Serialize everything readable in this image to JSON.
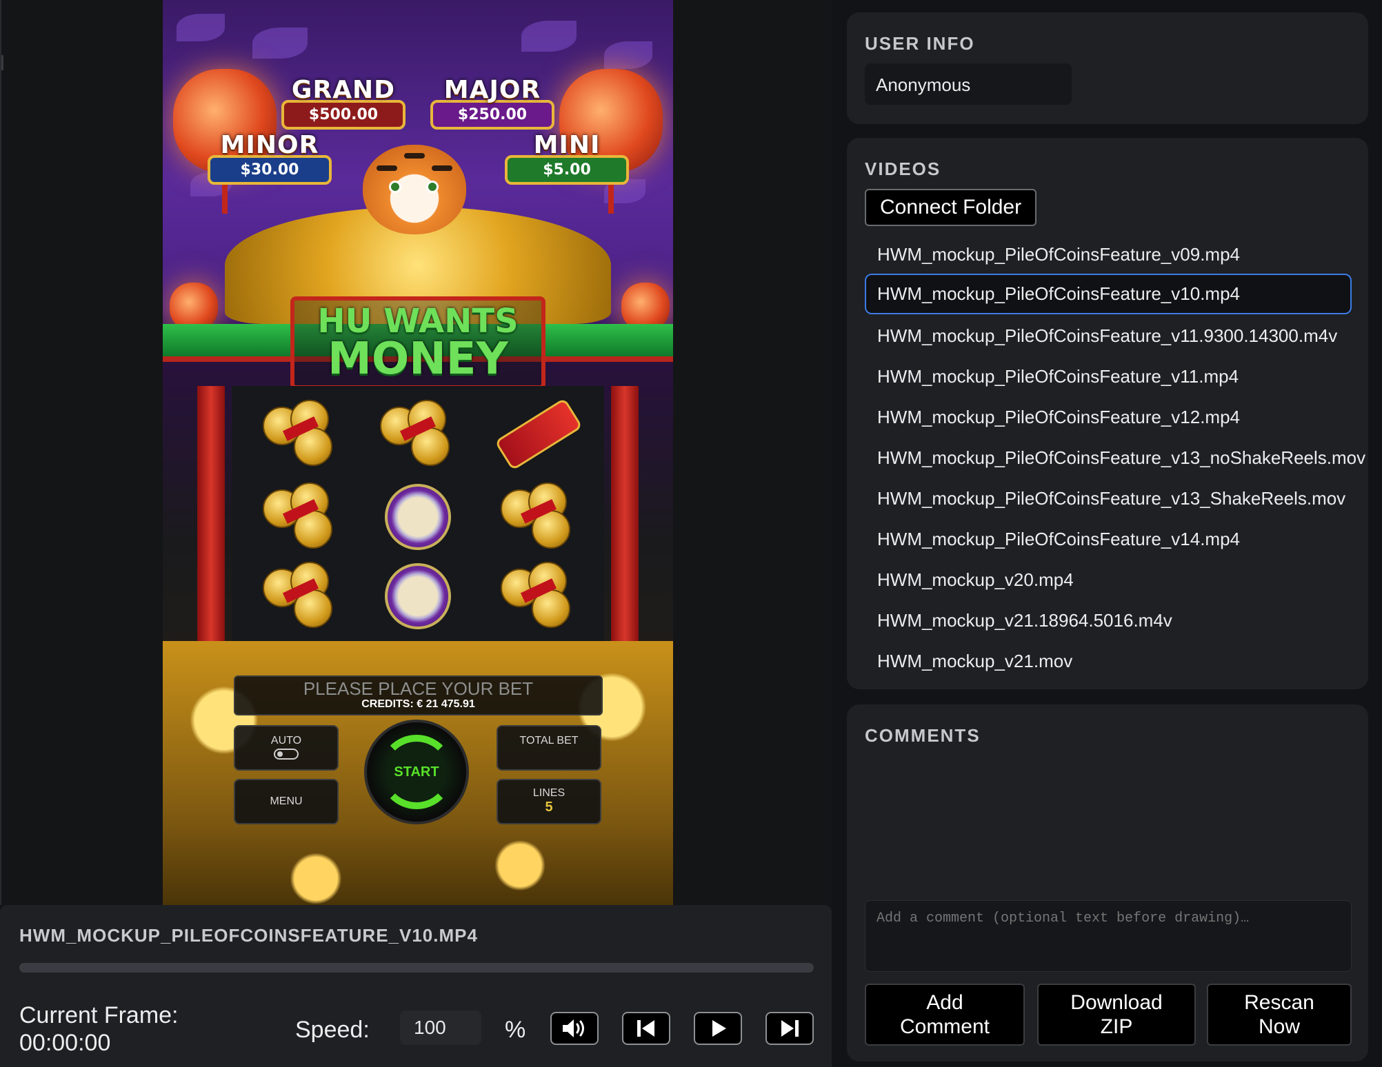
{
  "game": {
    "jackpots": [
      {
        "name": "GRAND",
        "value": "$500.00",
        "color": "#8e1b1b"
      },
      {
        "name": "MAJOR",
        "value": "$250.00",
        "color": "#6a1a8a"
      },
      {
        "name": "MINOR",
        "value": "$30.00",
        "color": "#1a3e8a"
      },
      {
        "name": "MINI",
        "value": "$5.00",
        "color": "#1f7a2a"
      }
    ],
    "title_line1": "HU WANTS",
    "title_line2": "MONEY",
    "bet_message": "PLEASE PLACE YOUR BET",
    "credits": "CREDITS: € 21 475.91",
    "buttons": {
      "auto": "AUTO",
      "menu": "MENU",
      "total_bet": "TOTAL BET",
      "lines": "LINES",
      "lines_value": "5",
      "start": "START"
    },
    "reel_symbols": [
      [
        "coins",
        "coins",
        "firecracker"
      ],
      [
        "coins",
        "drum",
        "coins"
      ],
      [
        "coins",
        "drum",
        "coins"
      ]
    ]
  },
  "player": {
    "file_title": "HWM_MOCKUP_PILEOFCOINSFEATURE_V10.MP4",
    "progress": 0,
    "current_frame_label": "Current Frame:",
    "current_frame_value": "00:00:00",
    "speed_label": "Speed:",
    "speed_value": "100",
    "speed_unit": "%",
    "controls": [
      "volume-icon",
      "skip-back-icon",
      "play-icon",
      "skip-forward-icon"
    ]
  },
  "user_info": {
    "heading": "USER INFO",
    "name": "Anonymous"
  },
  "videos": {
    "heading": "VIDEOS",
    "connect_label": "Connect Folder",
    "selected_index": 1,
    "items": [
      "HWM_mockup_PileOfCoinsFeature_v09.mp4",
      "HWM_mockup_PileOfCoinsFeature_v10.mp4",
      "HWM_mockup_PileOfCoinsFeature_v11.9300.14300.m4v",
      "HWM_mockup_PileOfCoinsFeature_v11.mp4",
      "HWM_mockup_PileOfCoinsFeature_v12.mp4",
      "HWM_mockup_PileOfCoinsFeature_v13_noShakeReels.mov",
      "HWM_mockup_PileOfCoinsFeature_v13_ShakeReels.mov",
      "HWM_mockup_PileOfCoinsFeature_v14.mp4",
      "HWM_mockup_v20.mp4",
      "HWM_mockup_v21.18964.5016.m4v",
      "HWM_mockup_v21.mov"
    ]
  },
  "comments": {
    "heading": "COMMENTS",
    "placeholder": "Add a comment (optional text before drawing)…",
    "add_label_1": "Add",
    "add_label_2": "Comment",
    "download_label_1": "Download",
    "download_label_2": "ZIP",
    "rescan_label_1": "Rescan",
    "rescan_label_2": "Now"
  }
}
